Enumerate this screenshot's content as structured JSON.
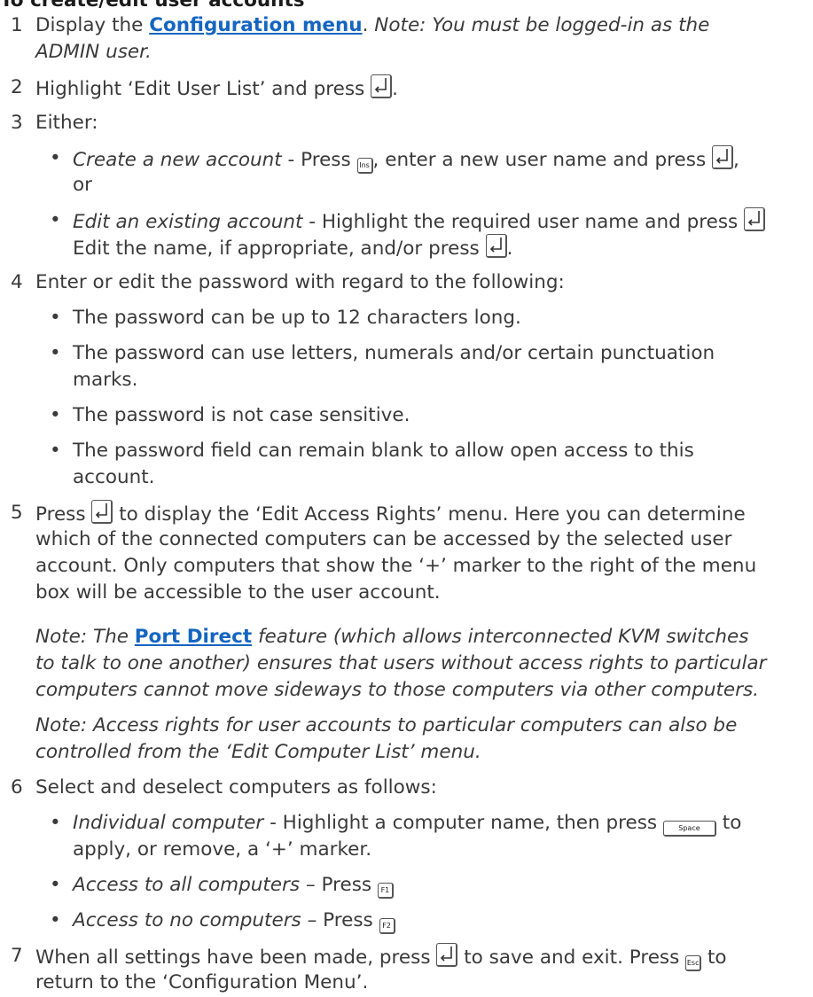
{
  "heading": "To create/edit user accounts",
  "keys": {
    "enter": "enter-key-icon",
    "ins": "Ins",
    "space": "Space",
    "f1": "F1",
    "f2": "F2",
    "esc": "Esc"
  },
  "colors": {
    "link": "#1565c0",
    "text": "#3a3a3a"
  },
  "steps": [
    {
      "number": "1",
      "pre": "Display the ",
      "link": "Configuration menu",
      "mid": ". ",
      "note": "Note: You must be logged-in as the",
      "note2": "ADMIN user."
    },
    {
      "number": "2",
      "pre": "Highlight ‘Edit User List’ and press ",
      "post": "."
    },
    {
      "number": "3",
      "text": "Either:",
      "b1_label": "Create a new account",
      "b1_a": " - Press ",
      "b1_b": ", enter a new user name and press ",
      "b1_c": ",",
      "b1_line2": "or",
      "b2_label": "Edit an existing account",
      "b2_a": " - Highlight the required user name and press ",
      "b2_line2a": "Edit the name, if appropriate, and/or press ",
      "b2_line2b": "."
    },
    {
      "number": "4",
      "text": "Enter or edit the password with regard to the following:",
      "bullets": [
        "The password can be up to 12 characters long.",
        "The password can use letters, numerals and/or certain punctuation",
        "marks.",
        "The password is not case sensitive.",
        "The password field can remain blank to allow open access to this",
        "account."
      ]
    },
    {
      "number": "5",
      "pre": "Press ",
      "line1": " to display the ‘Edit Access Rights’ menu. Here you can determine",
      "line2": "which of the connected computers can be accessed by the selected user",
      "line3": "account. Only computers that show the ‘+’ marker to the right of the menu",
      "line4": "box will be accessible to the user account.",
      "note1_pre": "Note: The ",
      "note1_link": "Port Direct",
      "note1_post": " feature (which allows interconnected KVM switches",
      "note1_l2": "to talk to one another) ensures that users without access rights to particular",
      "note1_l3": "computers cannot move sideways to those computers via other computers.",
      "note2_l1": "Note: Access rights for user accounts to particular computers can also be",
      "note2_l2": "controlled from the ‘Edit Computer List’ menu."
    },
    {
      "number": "6",
      "text": "Select and deselect computers as follows:",
      "b1_label": "Individual computer",
      "b1_a": " - Highlight a computer name, then press ",
      "b1_b": " to",
      "b1_line2": "apply, or remove, a ‘+’ marker.",
      "b2_label": "Access to all computers",
      "b2_a": " – Press ",
      "b3_label": "Access to no computers",
      "b3_a": " – Press "
    },
    {
      "number": "7",
      "pre": "When all settings have been made, press ",
      "mid": " to save and exit. Press ",
      "post": " to",
      "line2": "return to the ‘Configuration Menu’."
    }
  ]
}
